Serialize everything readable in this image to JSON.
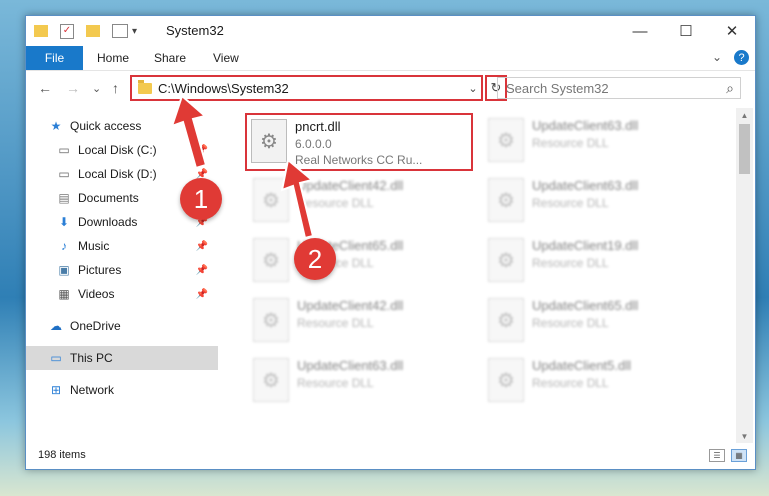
{
  "window": {
    "title": "System32",
    "controls": {
      "minimize": "—",
      "maximize": "☐",
      "close": "✕"
    }
  },
  "ribbon": {
    "tabs": [
      "File",
      "Home",
      "Share",
      "View"
    ],
    "expand_glyph": "⌄",
    "help_glyph": "?"
  },
  "navigation": {
    "back": "←",
    "forward": "→",
    "recent": "⌄",
    "up": "↑",
    "address_path": "C:\\Windows\\System32",
    "address_dropdown": "⌄",
    "refresh": "↻",
    "search_placeholder": "Search System32",
    "search_icon": "⌕"
  },
  "sidebar": {
    "items": [
      {
        "label": "Quick access",
        "icon": "star-icon",
        "glyph": "★",
        "pinned": false
      },
      {
        "label": "Local Disk (C:)",
        "icon": "drive-icon",
        "glyph": "▭",
        "pinned": true
      },
      {
        "label": "Local Disk (D:)",
        "icon": "drive-icon",
        "glyph": "▭",
        "pinned": true
      },
      {
        "label": "Documents",
        "icon": "documents-icon",
        "glyph": "▤",
        "pinned": true
      },
      {
        "label": "Downloads",
        "icon": "download-icon",
        "glyph": "⬇",
        "pinned": true
      },
      {
        "label": "Music",
        "icon": "music-icon",
        "glyph": "♪",
        "pinned": true
      },
      {
        "label": "Pictures",
        "icon": "pictures-icon",
        "glyph": "▣",
        "pinned": true
      },
      {
        "label": "Videos",
        "icon": "videos-icon",
        "glyph": "▦",
        "pinned": true
      },
      {
        "label": "OneDrive",
        "icon": "cloud-icon",
        "glyph": "☁",
        "pinned": false
      },
      {
        "label": "This PC",
        "icon": "computer-icon",
        "glyph": "▭",
        "pinned": false,
        "selected": true
      },
      {
        "label": "Network",
        "icon": "network-icon",
        "glyph": "⊞",
        "pinned": false
      }
    ],
    "pin_glyph": "📌"
  },
  "files": [
    {
      "name": "pncrt.dll",
      "line2": "6.0.0.0",
      "line3": "Real Networks CC Ru...",
      "highlighted": true
    },
    {
      "name": "UpdateClient63.dll",
      "line2": "Resource DLL",
      "line3": ""
    },
    {
      "name": "UpdateClient42.dll",
      "line2": "Resource DLL",
      "line3": ""
    },
    {
      "name": "UpdateClient63.dll",
      "line2": "Resource DLL",
      "line3": ""
    },
    {
      "name": "UpdateClient65.dll",
      "line2": "Resource DLL",
      "line3": ""
    },
    {
      "name": "UpdateClient19.dll",
      "line2": "Resource DLL",
      "line3": ""
    },
    {
      "name": "UpdateClient42.dll",
      "line2": "Resource DLL",
      "line3": ""
    },
    {
      "name": "UpdateClient65.dll",
      "line2": "Resource DLL",
      "line3": ""
    },
    {
      "name": "UpdateClient63.dll",
      "line2": "Resource DLL",
      "line3": ""
    },
    {
      "name": "UpdateClient5.dll",
      "line2": "Resource DLL",
      "line3": ""
    }
  ],
  "status": {
    "item_count": "198 items"
  },
  "annotations": {
    "step1": "1",
    "step2": "2",
    "color": "#e03a35"
  }
}
